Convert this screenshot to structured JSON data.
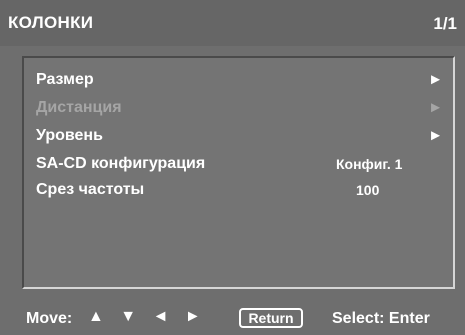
{
  "header": {
    "title": "КОЛОНКИ",
    "page": "1/1"
  },
  "menu": {
    "items": [
      {
        "label": "Размер",
        "value": "",
        "arrow": "►",
        "enabled": true
      },
      {
        "label": "Дистанция",
        "value": "",
        "arrow": "►",
        "enabled": false
      },
      {
        "label": "Уровень",
        "value": "",
        "arrow": "►",
        "enabled": true
      },
      {
        "label": "SA-CD конфигурация",
        "value": "Конфиг. 1",
        "arrow": "",
        "enabled": true
      },
      {
        "label": "Срез частоты",
        "value": "100",
        "arrow": "",
        "enabled": true
      }
    ]
  },
  "footer": {
    "move_label": "Move:",
    "move_arrows": "▲ ▼ ◄ ►",
    "return_label": "Return",
    "select_label": "Select: Enter"
  },
  "colors": {
    "background": "#6e6e6e",
    "header": "#666666",
    "text": "#ffffff",
    "disabled_text": "#a5a5a5"
  }
}
